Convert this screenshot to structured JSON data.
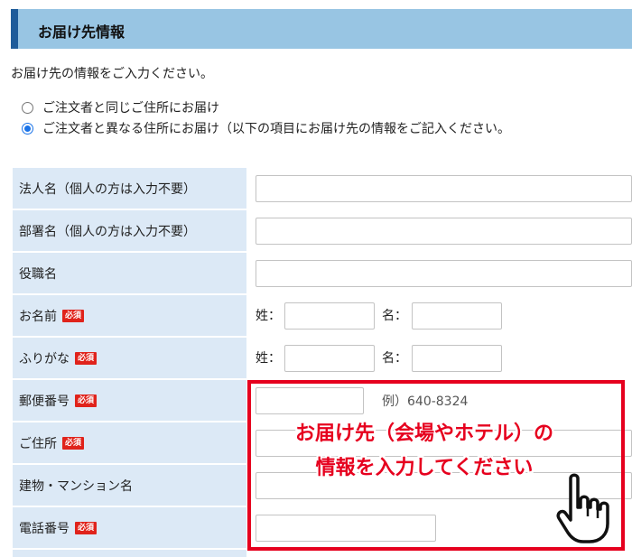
{
  "section": {
    "title": "お届け先情報"
  },
  "intro_text": "お届け先の情報をご入力ください。",
  "options": [
    {
      "label": "ご注文者と同じご住所にお届け",
      "checked": false
    },
    {
      "label": "ご注文者と異なる住所にお届け（以下の項目にお届け先の情報をご記入ください。",
      "checked": true
    }
  ],
  "required_badge": "必須",
  "rows": [
    {
      "label": "法人名（個人の方は入力不要）"
    },
    {
      "label": "部署名（個人の方は入力不要）"
    },
    {
      "label": "役職名"
    },
    {
      "label": "お名前",
      "last_label": "姓：",
      "first_label": "名："
    },
    {
      "label": "ふりがな",
      "last_label": "姓：",
      "first_label": "名："
    },
    {
      "label": "郵便番号",
      "example": "例）640-8324"
    },
    {
      "label": "ご住所"
    },
    {
      "label": "建物・マンション名"
    },
    {
      "label": "電話番号"
    }
  ],
  "callout": {
    "line1": "お届け先（会場やホテル）の",
    "line2": "情報を入力してください"
  },
  "colors": {
    "header_bg": "#98c5e3",
    "header_accent": "#1f5c9a",
    "label_bg": "#dce9f6",
    "callout": "#e6001e",
    "required": "#e0231b"
  },
  "icons": [
    "pointing-hand-icon"
  ]
}
